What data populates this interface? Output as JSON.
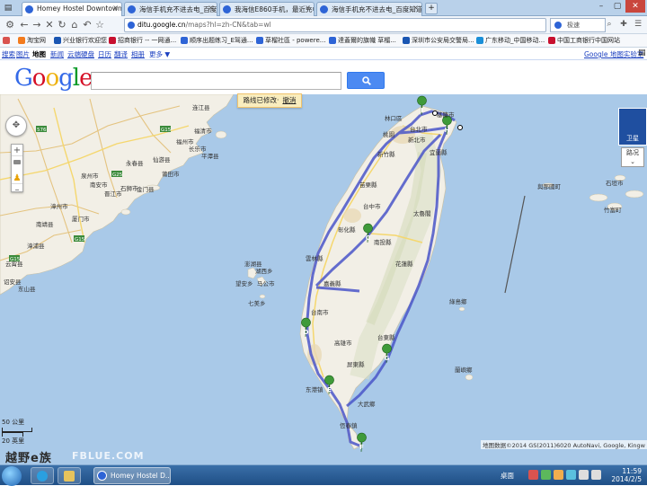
{
  "browser": {
    "tabs": [
      {
        "label": "Homey Hostel Downtown",
        "active": true
      },
      {
        "label": "海信手机充不进去电_百度搜索",
        "active": false
      },
      {
        "label": "我海信E860手机，最近充电你",
        "active": false
      },
      {
        "label": "海信手机充不进去电_百度知道",
        "active": false
      }
    ],
    "url_host": "ditu.google.cn",
    "url_path": "/maps?hl=zh-CN&tab=wl",
    "search_engine": "极速",
    "bookmarks": [
      "淘宝网",
      "兴业银行欢迎您",
      "招商银行 -- 一网通...",
      "顺序出题练习_E驾通...",
      "草榴社區 - powere...",
      "達蓋爾的旗幟 草榴...",
      "深圳市公安局交警局...",
      "广东移动_中国移动...",
      "中国工商银行中国网站"
    ]
  },
  "gbar": {
    "items": [
      "搜索",
      "图片",
      "地图",
      "新闻",
      "云端硬盘",
      "日历",
      "翻译",
      "相册",
      "更多 ▼"
    ],
    "current": "地图",
    "labs": "Google 地图实验室"
  },
  "logo": "Google",
  "search": {
    "placeholder": ""
  },
  "notice": {
    "text": "路线已修改·",
    "undo": "撤消"
  },
  "map": {
    "type_label": "卫星",
    "traffic_label": "路况",
    "scale_km": "50 公里",
    "scale_mi": "20 英里",
    "attribution": "地图数据©2014 GS(2011)6020 AutoNavi, Google, Kingw",
    "route_color": "#4b56c9",
    "sea_color": "#a9c9e8",
    "land_color": "#f2efe6",
    "markers": [
      "I",
      "H",
      "C",
      "D",
      "E",
      "F",
      "G"
    ],
    "labels": [
      "福州市",
      "长乐市",
      "泉州市",
      "厦门市",
      "漳州市",
      "晋江市",
      "石狮市",
      "仙游县",
      "南安市",
      "永春县",
      "莆田市",
      "福清市",
      "平潭县",
      "连江县",
      "南靖县",
      "漳浦县",
      "云霄县",
      "诏安县",
      "东山县",
      "湖西乡",
      "马公市",
      "望安乡",
      "金门县",
      "澎湖县",
      "七美乡",
      "台北市",
      "新北市",
      "林口區",
      "桃園",
      "基隆市",
      "宜蘭縣",
      "新竹縣",
      "苗栗縣",
      "台中市",
      "南投縣",
      "嘉義縣",
      "彰化縣",
      "雲林縣",
      "台南市",
      "高雄市",
      "屏東縣",
      "台東縣",
      "花蓮縣",
      "太魯閣",
      "恆春鎮",
      "綠島鄉",
      "蘭嶼鄉",
      "與那國町",
      "竹富町",
      "石垣市",
      "东港镇",
      "大武鄉"
    ]
  },
  "watermark": {
    "text": "越野e族",
    "site": "FBLUE.COM"
  },
  "taskbar": {
    "active_window": "Homey Hostel D...",
    "desktop_label": "桌面",
    "time": "11:59",
    "date": "2014/2/5"
  }
}
